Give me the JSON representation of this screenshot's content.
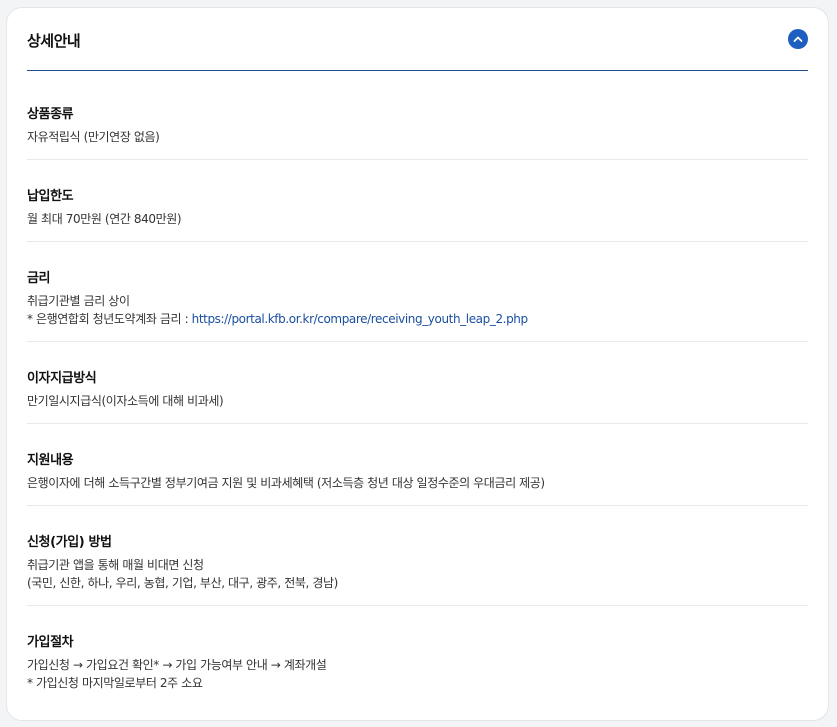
{
  "header": {
    "title": "상세안내"
  },
  "sections": [
    {
      "title": "상품종류",
      "lines": [
        "자유적립식 (만기연장 없음)"
      ]
    },
    {
      "title": "납입한도",
      "lines": [
        "월 최대 70만원 (연간 840만원)"
      ]
    },
    {
      "title": "금리",
      "lines": [
        "취급기관별 금리 상이"
      ],
      "note_prefix": "* 은행연합회 청년도약계좌 금리 : ",
      "link": "https://portal.kfb.or.kr/compare/receiving_youth_leap_2.php"
    },
    {
      "title": "이자지급방식",
      "lines": [
        "만기일시지급식(이자소득에 대해 비과세)"
      ]
    },
    {
      "title": "지원내용",
      "lines": [
        "은행이자에 더해 소득구간별 정부기여금 지원 및 비과세혜택 (저소득층 청년 대상 일정수준의 우대금리 제공)"
      ]
    },
    {
      "title": "신청(가입) 방법",
      "lines": [
        "취급기관 앱을 통해 매월 비대면 신청",
        "(국민, 신한, 하나, 우리, 농협, 기업, 부산, 대구, 광주, 전북, 경남)"
      ]
    },
    {
      "title": "가입절차",
      "lines": [
        "가입신청 → 가입요건 확인* → 가입 가능여부 안내 → 계좌개설",
        "* 가입신청 마지막일로부터 2주 소요"
      ]
    }
  ],
  "icons": {
    "toggle": "chevron-up-icon"
  },
  "colors": {
    "accent": "#1d5fc1",
    "link": "#1a4fa0",
    "header_rule": "#1e4e8c"
  }
}
